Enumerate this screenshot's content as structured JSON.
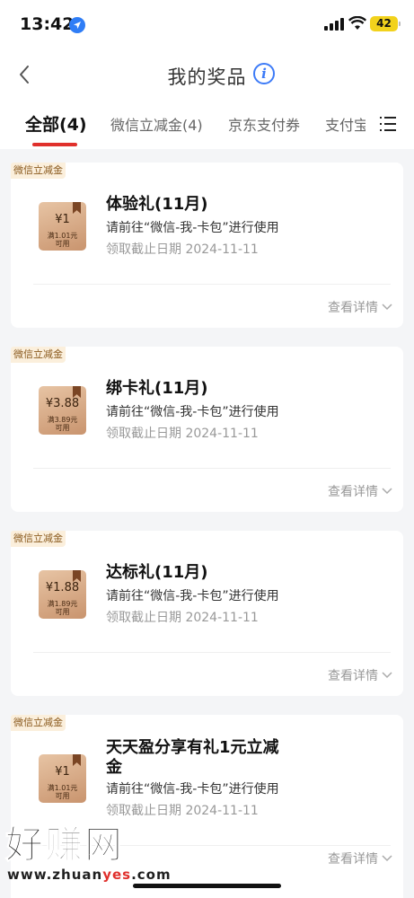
{
  "status_bar": {
    "time": "13:42",
    "battery": "42"
  },
  "nav": {
    "title": "我的奖品",
    "info_icon": "i"
  },
  "tabs": [
    {
      "label": "全部(4)",
      "active": true
    },
    {
      "label": "微信立减金(4)",
      "active": false
    },
    {
      "label": "京东支付券",
      "active": false
    },
    {
      "label": "支付宝",
      "active": false
    }
  ],
  "accent_color": "#e0302c",
  "cards": [
    {
      "tag": "微信立减金",
      "coupon_amount": "¥1",
      "coupon_condition_1": "满1.01元",
      "coupon_condition_2": "可用",
      "title": "体验礼(11月)",
      "desc": "请前往“微信-我-卡包”进行使用",
      "deadline": "领取截止日期 2024-11-11",
      "detail": "查看详情"
    },
    {
      "tag": "微信立减金",
      "coupon_amount": "¥3.88",
      "coupon_condition_1": "满3.89元",
      "coupon_condition_2": "可用",
      "title": "绑卡礼(11月)",
      "desc": "请前往“微信-我-卡包”进行使用",
      "deadline": "领取截止日期 2024-11-11",
      "detail": "查看详情"
    },
    {
      "tag": "微信立减金",
      "coupon_amount": "¥1.88",
      "coupon_condition_1": "满1.89元",
      "coupon_condition_2": "可用",
      "title": "达标礼(11月)",
      "desc": "请前往“微信-我-卡包”进行使用",
      "deadline": "领取截止日期 2024-11-11",
      "detail": "查看详情"
    },
    {
      "tag": "微信立减金",
      "coupon_amount": "¥1",
      "coupon_condition_1": "满1.01元",
      "coupon_condition_2": "可用",
      "title_line1": "天天盈分享有礼1元立减",
      "title_line2": "金",
      "desc": "请前往“微信-我-卡包”进行使用",
      "deadline": "领取截止日期 2024-11-11",
      "detail": "查看详情"
    }
  ],
  "watermark": {
    "main": "好赚网",
    "url_prefix": "www.zhuan",
    "url_highlight": "yes",
    "url_suffix": ".com"
  }
}
